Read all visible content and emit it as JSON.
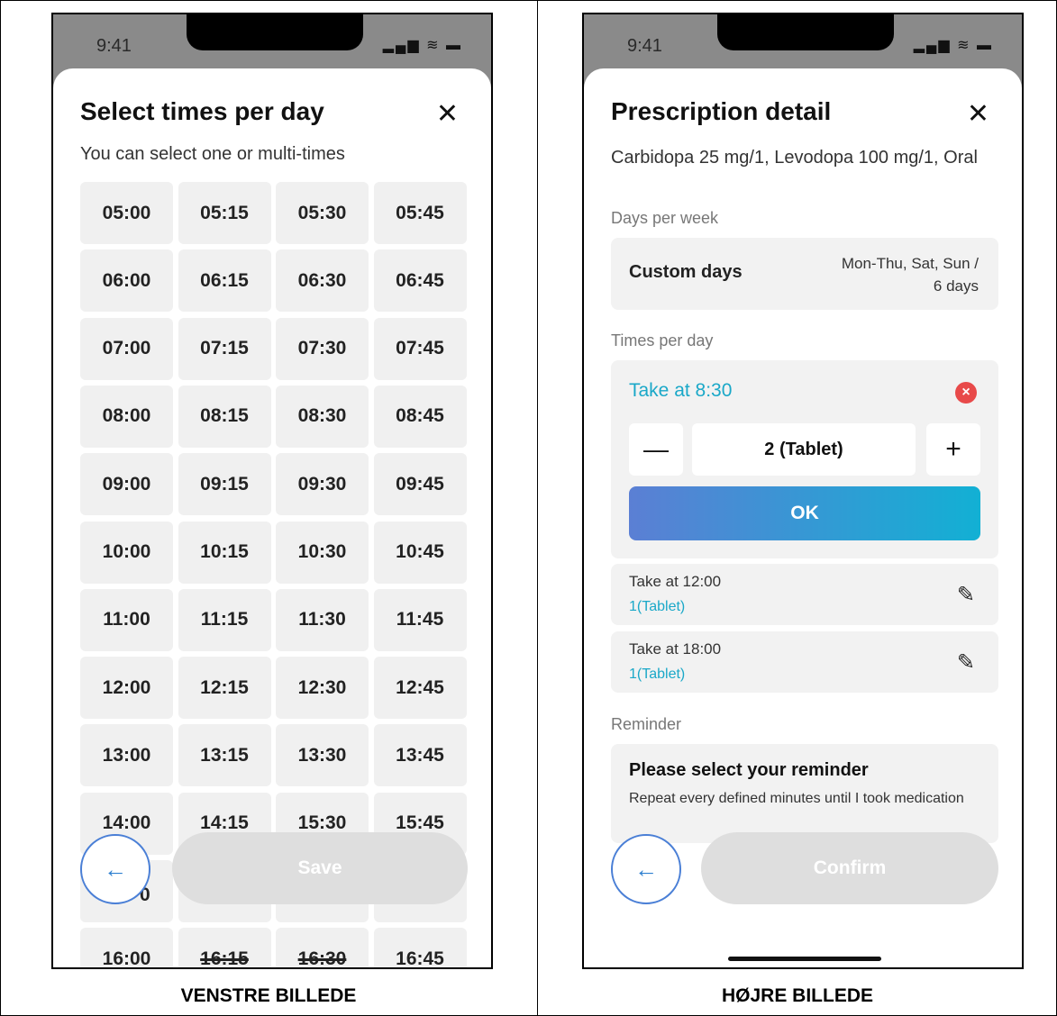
{
  "left": {
    "status_time": "9:41",
    "title": "Select times per day",
    "subtitle": "You can select one or multi-times",
    "times": [
      [
        "05:00",
        "05:15",
        "05:30",
        "05:45"
      ],
      [
        "06:00",
        "06:15",
        "06:30",
        "06:45"
      ],
      [
        "07:00",
        "07:15",
        "07:30",
        "07:45"
      ],
      [
        "08:00",
        "08:15",
        "08:30",
        "08:45"
      ],
      [
        "09:00",
        "09:15",
        "09:30",
        "09:45"
      ],
      [
        "10:00",
        "10:15",
        "10:30",
        "10:45"
      ],
      [
        "11:00",
        "11:15",
        "11:30",
        "11:45"
      ],
      [
        "12:00",
        "12:15",
        "12:30",
        "12:45"
      ],
      [
        "13:00",
        "13:15",
        "13:30",
        "13:45"
      ],
      [
        "14:00",
        "14:15",
        "15:30",
        "15:45"
      ],
      [
        "",
        "",
        "",
        ""
      ],
      [
        "16:00",
        "16:15",
        "16:30",
        "16:45"
      ]
    ],
    "partial_cell_text": "0",
    "save_label": "Save",
    "caption": "VENSTRE BILLEDE"
  },
  "right": {
    "status_time": "9:41",
    "title": "Prescription detail",
    "drug": "Carbidopa 25 mg/1, Levodopa 100 mg/1, Oral",
    "days_label": "Days per week",
    "custom_days": "Custom days",
    "days_value": "Mon-Thu, Sat, Sun /",
    "days_count": "6 days",
    "times_label": "Times per day",
    "active_time": "Take at 8:30",
    "quantity": "2 (Tablet)",
    "ok_label": "OK",
    "doses": [
      {
        "time": "Take at 12:00",
        "amount": "1(Tablet)"
      },
      {
        "time": "Take at 18:00",
        "amount": "1(Tablet)"
      }
    ],
    "reminder_label": "Reminder",
    "reminder_title": "Please select your reminder",
    "reminder_desc": "Repeat every defined minutes until I took medication",
    "confirm_label": "Confirm",
    "caption": "HØJRE BILLEDE"
  },
  "icons": [
    "close-icon",
    "back-arrow-icon",
    "minus-icon",
    "plus-icon",
    "remove-icon",
    "edit-pencil-icon",
    "signal-icon",
    "wifi-icon",
    "battery-icon"
  ],
  "colors": {
    "accent": "#1aa8c8",
    "ok_start": "#5b7fd4",
    "ok_end": "#12b0d4",
    "remove": "#e84a4a",
    "disabled_button": "#dedede"
  }
}
